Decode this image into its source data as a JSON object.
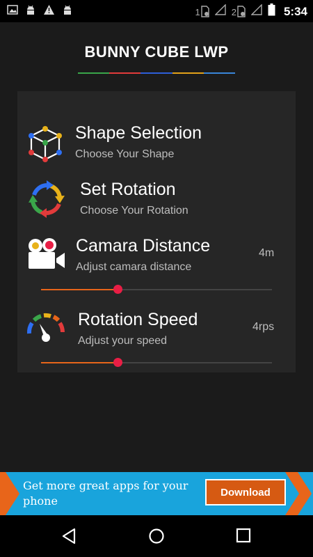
{
  "status_bar": {
    "sim1": "1",
    "sim2": "2",
    "time": "5:34"
  },
  "app_title": "BUNNY CUBE LWP",
  "title_underline_colors": [
    "#3aa64a",
    "#e23b3b",
    "#2e5fd9",
    "#e3a21a",
    "#3a86d9"
  ],
  "settings": [
    {
      "label": "Shape Selection",
      "sub": "Choose Your Shape",
      "icon": "cube-icon"
    },
    {
      "label": "Set Rotation",
      "sub": "Choose Your Rotation",
      "icon": "rotation-arrows-icon"
    },
    {
      "label": "Camara Distance",
      "sub": "Adjust camara distance",
      "value": "4m",
      "icon": "video-camera-icon",
      "slider_fraction": 0.33
    },
    {
      "label": "Rotation Speed",
      "sub": "Adjust your speed",
      "value": "4rps",
      "icon": "speedometer-icon",
      "slider_fraction": 0.33
    }
  ],
  "ad": {
    "text": "Get more great apps for your phone",
    "button": "Download"
  },
  "colors": {
    "slider_fill": "#e8651a",
    "slider_thumb": "#e91e45",
    "ad_background": "#19a4dc",
    "ad_button": "#d65a12"
  }
}
